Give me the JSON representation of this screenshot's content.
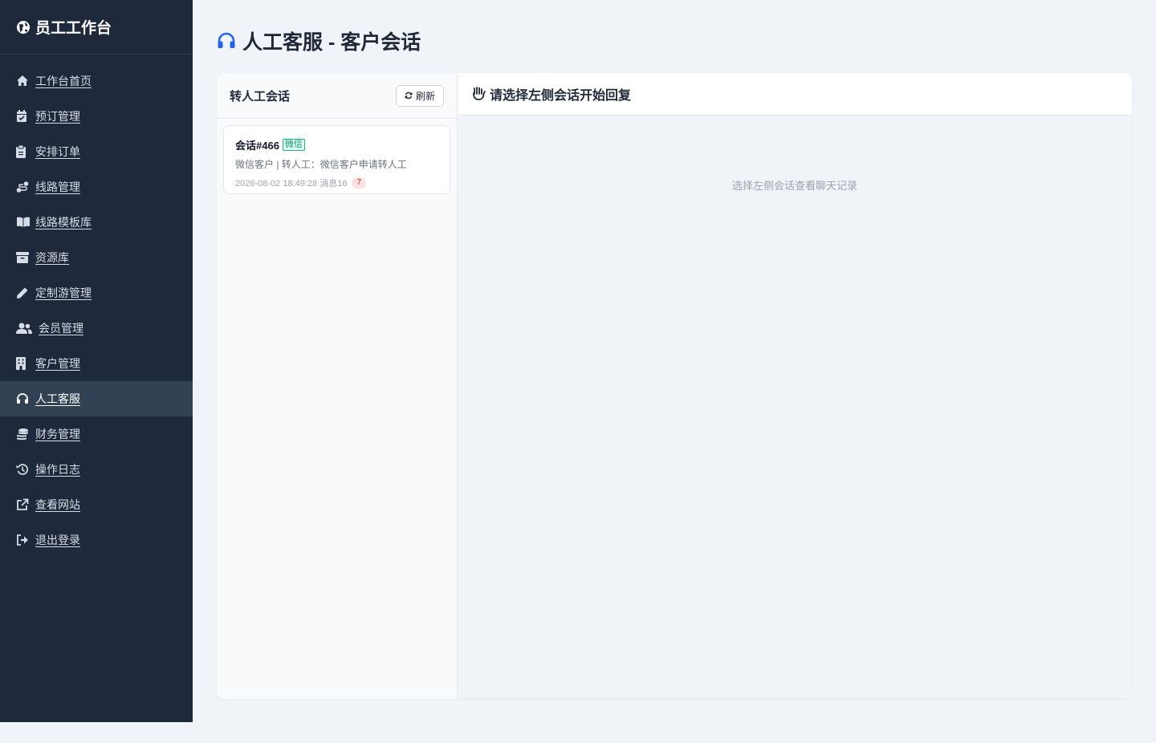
{
  "sidebar": {
    "brand": "员工工作台",
    "items": [
      {
        "label": "工作台首页",
        "icon": "home-icon"
      },
      {
        "label": "预订管理",
        "icon": "calendar-check-icon"
      },
      {
        "label": "安排订单",
        "icon": "clipboard-icon"
      },
      {
        "label": "线路管理",
        "icon": "route-icon"
      },
      {
        "label": "线路模板库",
        "icon": "book-icon"
      },
      {
        "label": "资源库",
        "icon": "archive-icon"
      },
      {
        "label": "定制游管理",
        "icon": "pencil-icon"
      },
      {
        "label": "会员管理",
        "icon": "users-icon"
      },
      {
        "label": "客户管理",
        "icon": "building-icon"
      },
      {
        "label": "人工客服",
        "icon": "headset-icon",
        "active": true
      },
      {
        "label": "财务管理",
        "icon": "coins-icon"
      },
      {
        "label": "操作日志",
        "icon": "history-icon"
      },
      {
        "label": "查看网站",
        "icon": "external-link-icon"
      },
      {
        "label": "退出登录",
        "icon": "sign-out-icon"
      }
    ]
  },
  "page": {
    "title": "人工客服 - 客户会话"
  },
  "conversation_list": {
    "title": "转人工会话",
    "refresh_label": "刷新",
    "items": [
      {
        "title": "会话#466",
        "channel": "微信",
        "description": "微信客户 | 转人工：微信客户申请转人工",
        "meta": "2026-08-02 18:49:28 消息16",
        "unread": "7"
      }
    ]
  },
  "chat": {
    "header": "请选择左侧会话开始回复",
    "empty_text": "选择左侧会话查看聊天记录"
  },
  "colors": {
    "sidebar_bg": "#1e293b",
    "sidebar_active": "#334155",
    "accent": "#2563eb",
    "channel_green": "#10b981",
    "unread_red": "#dc2626"
  }
}
